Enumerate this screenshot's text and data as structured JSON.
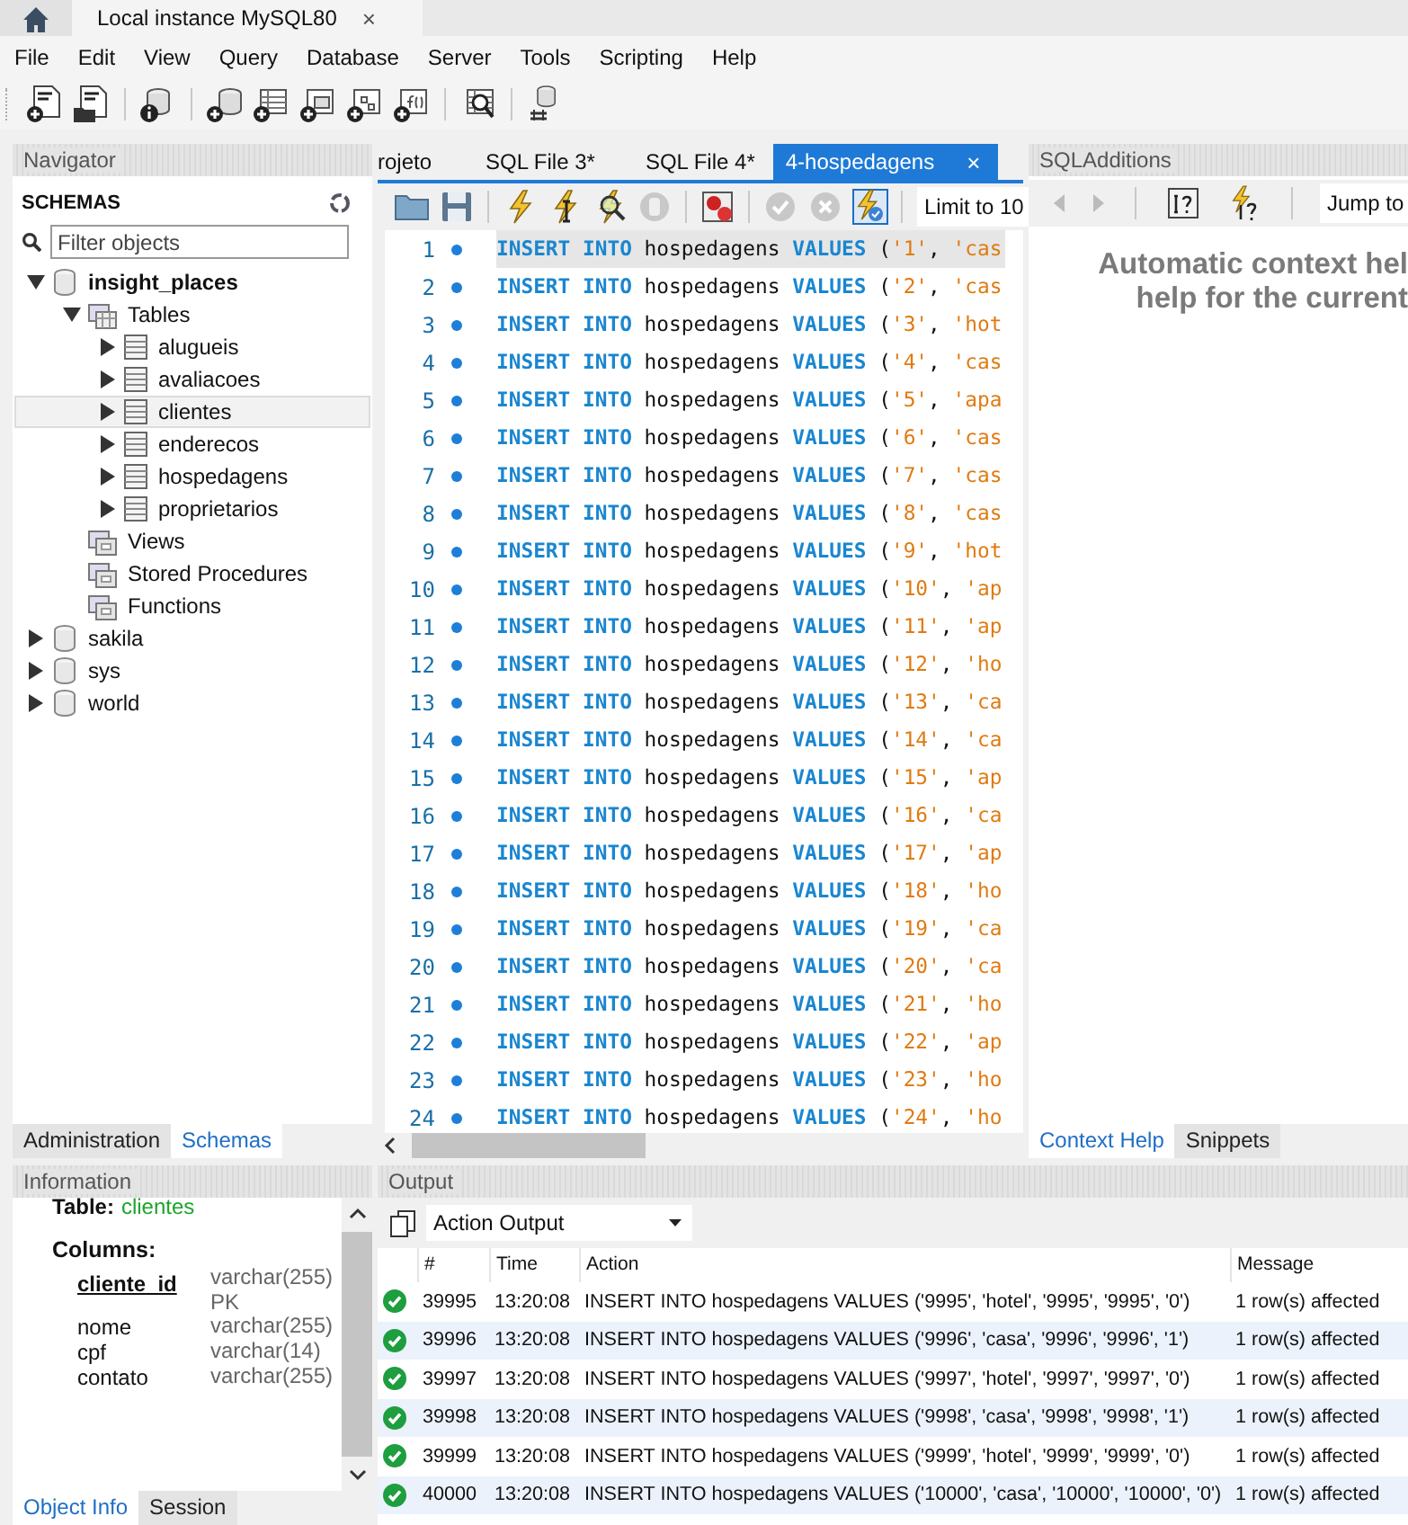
{
  "connection_tab": {
    "label": "Local instance MySQL80",
    "close": "×"
  },
  "menu": [
    "File",
    "Edit",
    "View",
    "Query",
    "Database",
    "Server",
    "Tools",
    "Scripting",
    "Help"
  ],
  "navigator": {
    "title": "Navigator",
    "heading": "SCHEMAS",
    "filter": {
      "placeholder": "Filter objects"
    },
    "tree": [
      {
        "label": "insight_places",
        "kind": "schema",
        "default": true,
        "expanded": true,
        "selected": false,
        "children": [
          {
            "label": "Tables",
            "kind": "folder",
            "expanded": true,
            "selected": false,
            "children": [
              {
                "label": "alugueis",
                "kind": "table",
                "expanded": false,
                "selected": false
              },
              {
                "label": "avaliacoes",
                "kind": "table",
                "expanded": false,
                "selected": false
              },
              {
                "label": "clientes",
                "kind": "table",
                "expanded": false,
                "selected": true
              },
              {
                "label": "enderecos",
                "kind": "table",
                "expanded": false,
                "selected": false
              },
              {
                "label": "hospedagens",
                "kind": "table",
                "expanded": false,
                "selected": false
              },
              {
                "label": "proprietarios",
                "kind": "table",
                "expanded": false,
                "selected": false
              }
            ]
          },
          {
            "label": "Views",
            "kind": "group",
            "selected": false
          },
          {
            "label": "Stored Procedures",
            "kind": "group",
            "selected": false
          },
          {
            "label": "Functions",
            "kind": "group",
            "selected": false
          }
        ]
      },
      {
        "label": "sakila",
        "kind": "schema",
        "default": false,
        "expanded": false,
        "selected": false
      },
      {
        "label": "sys",
        "kind": "schema",
        "default": false,
        "expanded": false,
        "selected": false
      },
      {
        "label": "world",
        "kind": "schema",
        "default": false,
        "expanded": false,
        "selected": false
      }
    ],
    "tabs": [
      {
        "label": "Administration",
        "selected": false
      },
      {
        "label": "Schemas",
        "selected": true
      }
    ]
  },
  "editor": {
    "tabs": [
      {
        "label": "rojeto",
        "selected": false
      },
      {
        "label": "SQL File 3*",
        "selected": false
      },
      {
        "label": "SQL File 4*",
        "selected": false
      },
      {
        "label": "4-hospedagens",
        "selected": true,
        "close": "×"
      }
    ],
    "limit": {
      "value": "Limit to 10"
    },
    "lines": [
      {
        "number": "1",
        "current": true,
        "tokens": [
          {
            "kind": "keyword",
            "text": "INSERT INTO "
          },
          {
            "kind": "plain",
            "text": "hospedagens "
          },
          {
            "kind": "keyword",
            "text": "VALUES "
          },
          {
            "kind": "plain",
            "text": "("
          },
          {
            "kind": "string",
            "text": "'1'"
          },
          {
            "kind": "plain",
            "text": ", "
          },
          {
            "kind": "string",
            "text": "'cas"
          }
        ]
      },
      {
        "number": "2",
        "current": false,
        "tokens": [
          {
            "kind": "keyword",
            "text": "INSERT INTO "
          },
          {
            "kind": "plain",
            "text": "hospedagens "
          },
          {
            "kind": "keyword",
            "text": "VALUES "
          },
          {
            "kind": "plain",
            "text": "("
          },
          {
            "kind": "string",
            "text": "'2'"
          },
          {
            "kind": "plain",
            "text": ", "
          },
          {
            "kind": "string",
            "text": "'cas"
          }
        ]
      },
      {
        "number": "3",
        "current": false,
        "tokens": [
          {
            "kind": "keyword",
            "text": "INSERT INTO "
          },
          {
            "kind": "plain",
            "text": "hospedagens "
          },
          {
            "kind": "keyword",
            "text": "VALUES "
          },
          {
            "kind": "plain",
            "text": "("
          },
          {
            "kind": "string",
            "text": "'3'"
          },
          {
            "kind": "plain",
            "text": ", "
          },
          {
            "kind": "string",
            "text": "'hot"
          }
        ]
      },
      {
        "number": "4",
        "current": false,
        "tokens": [
          {
            "kind": "keyword",
            "text": "INSERT INTO "
          },
          {
            "kind": "plain",
            "text": "hospedagens "
          },
          {
            "kind": "keyword",
            "text": "VALUES "
          },
          {
            "kind": "plain",
            "text": "("
          },
          {
            "kind": "string",
            "text": "'4'"
          },
          {
            "kind": "plain",
            "text": ", "
          },
          {
            "kind": "string",
            "text": "'cas"
          }
        ]
      },
      {
        "number": "5",
        "current": false,
        "tokens": [
          {
            "kind": "keyword",
            "text": "INSERT INTO "
          },
          {
            "kind": "plain",
            "text": "hospedagens "
          },
          {
            "kind": "keyword",
            "text": "VALUES "
          },
          {
            "kind": "plain",
            "text": "("
          },
          {
            "kind": "string",
            "text": "'5'"
          },
          {
            "kind": "plain",
            "text": ", "
          },
          {
            "kind": "string",
            "text": "'apa"
          }
        ]
      },
      {
        "number": "6",
        "current": false,
        "tokens": [
          {
            "kind": "keyword",
            "text": "INSERT INTO "
          },
          {
            "kind": "plain",
            "text": "hospedagens "
          },
          {
            "kind": "keyword",
            "text": "VALUES "
          },
          {
            "kind": "plain",
            "text": "("
          },
          {
            "kind": "string",
            "text": "'6'"
          },
          {
            "kind": "plain",
            "text": ", "
          },
          {
            "kind": "string",
            "text": "'cas"
          }
        ]
      },
      {
        "number": "7",
        "current": false,
        "tokens": [
          {
            "kind": "keyword",
            "text": "INSERT INTO "
          },
          {
            "kind": "plain",
            "text": "hospedagens "
          },
          {
            "kind": "keyword",
            "text": "VALUES "
          },
          {
            "kind": "plain",
            "text": "("
          },
          {
            "kind": "string",
            "text": "'7'"
          },
          {
            "kind": "plain",
            "text": ", "
          },
          {
            "kind": "string",
            "text": "'cas"
          }
        ]
      },
      {
        "number": "8",
        "current": false,
        "tokens": [
          {
            "kind": "keyword",
            "text": "INSERT INTO "
          },
          {
            "kind": "plain",
            "text": "hospedagens "
          },
          {
            "kind": "keyword",
            "text": "VALUES "
          },
          {
            "kind": "plain",
            "text": "("
          },
          {
            "kind": "string",
            "text": "'8'"
          },
          {
            "kind": "plain",
            "text": ", "
          },
          {
            "kind": "string",
            "text": "'cas"
          }
        ]
      },
      {
        "number": "9",
        "current": false,
        "tokens": [
          {
            "kind": "keyword",
            "text": "INSERT INTO "
          },
          {
            "kind": "plain",
            "text": "hospedagens "
          },
          {
            "kind": "keyword",
            "text": "VALUES "
          },
          {
            "kind": "plain",
            "text": "("
          },
          {
            "kind": "string",
            "text": "'9'"
          },
          {
            "kind": "plain",
            "text": ", "
          },
          {
            "kind": "string",
            "text": "'hot"
          }
        ]
      },
      {
        "number": "10",
        "current": false,
        "tokens": [
          {
            "kind": "keyword",
            "text": "INSERT INTO "
          },
          {
            "kind": "plain",
            "text": "hospedagens "
          },
          {
            "kind": "keyword",
            "text": "VALUES "
          },
          {
            "kind": "plain",
            "text": "("
          },
          {
            "kind": "string",
            "text": "'10'"
          },
          {
            "kind": "plain",
            "text": ", "
          },
          {
            "kind": "string",
            "text": "'ap"
          }
        ]
      },
      {
        "number": "11",
        "current": false,
        "tokens": [
          {
            "kind": "keyword",
            "text": "INSERT INTO "
          },
          {
            "kind": "plain",
            "text": "hospedagens "
          },
          {
            "kind": "keyword",
            "text": "VALUES "
          },
          {
            "kind": "plain",
            "text": "("
          },
          {
            "kind": "string",
            "text": "'11'"
          },
          {
            "kind": "plain",
            "text": ", "
          },
          {
            "kind": "string",
            "text": "'ap"
          }
        ]
      },
      {
        "number": "12",
        "current": false,
        "tokens": [
          {
            "kind": "keyword",
            "text": "INSERT INTO "
          },
          {
            "kind": "plain",
            "text": "hospedagens "
          },
          {
            "kind": "keyword",
            "text": "VALUES "
          },
          {
            "kind": "plain",
            "text": "("
          },
          {
            "kind": "string",
            "text": "'12'"
          },
          {
            "kind": "plain",
            "text": ", "
          },
          {
            "kind": "string",
            "text": "'ho"
          }
        ]
      },
      {
        "number": "13",
        "current": false,
        "tokens": [
          {
            "kind": "keyword",
            "text": "INSERT INTO "
          },
          {
            "kind": "plain",
            "text": "hospedagens "
          },
          {
            "kind": "keyword",
            "text": "VALUES "
          },
          {
            "kind": "plain",
            "text": "("
          },
          {
            "kind": "string",
            "text": "'13'"
          },
          {
            "kind": "plain",
            "text": ", "
          },
          {
            "kind": "string",
            "text": "'ca"
          }
        ]
      },
      {
        "number": "14",
        "current": false,
        "tokens": [
          {
            "kind": "keyword",
            "text": "INSERT INTO "
          },
          {
            "kind": "plain",
            "text": "hospedagens "
          },
          {
            "kind": "keyword",
            "text": "VALUES "
          },
          {
            "kind": "plain",
            "text": "("
          },
          {
            "kind": "string",
            "text": "'14'"
          },
          {
            "kind": "plain",
            "text": ", "
          },
          {
            "kind": "string",
            "text": "'ca"
          }
        ]
      },
      {
        "number": "15",
        "current": false,
        "tokens": [
          {
            "kind": "keyword",
            "text": "INSERT INTO "
          },
          {
            "kind": "plain",
            "text": "hospedagens "
          },
          {
            "kind": "keyword",
            "text": "VALUES "
          },
          {
            "kind": "plain",
            "text": "("
          },
          {
            "kind": "string",
            "text": "'15'"
          },
          {
            "kind": "plain",
            "text": ", "
          },
          {
            "kind": "string",
            "text": "'ap"
          }
        ]
      },
      {
        "number": "16",
        "current": false,
        "tokens": [
          {
            "kind": "keyword",
            "text": "INSERT INTO "
          },
          {
            "kind": "plain",
            "text": "hospedagens "
          },
          {
            "kind": "keyword",
            "text": "VALUES "
          },
          {
            "kind": "plain",
            "text": "("
          },
          {
            "kind": "string",
            "text": "'16'"
          },
          {
            "kind": "plain",
            "text": ", "
          },
          {
            "kind": "string",
            "text": "'ca"
          }
        ]
      },
      {
        "number": "17",
        "current": false,
        "tokens": [
          {
            "kind": "keyword",
            "text": "INSERT INTO "
          },
          {
            "kind": "plain",
            "text": "hospedagens "
          },
          {
            "kind": "keyword",
            "text": "VALUES "
          },
          {
            "kind": "plain",
            "text": "("
          },
          {
            "kind": "string",
            "text": "'17'"
          },
          {
            "kind": "plain",
            "text": ", "
          },
          {
            "kind": "string",
            "text": "'ap"
          }
        ]
      },
      {
        "number": "18",
        "current": false,
        "tokens": [
          {
            "kind": "keyword",
            "text": "INSERT INTO "
          },
          {
            "kind": "plain",
            "text": "hospedagens "
          },
          {
            "kind": "keyword",
            "text": "VALUES "
          },
          {
            "kind": "plain",
            "text": "("
          },
          {
            "kind": "string",
            "text": "'18'"
          },
          {
            "kind": "plain",
            "text": ", "
          },
          {
            "kind": "string",
            "text": "'ho"
          }
        ]
      },
      {
        "number": "19",
        "current": false,
        "tokens": [
          {
            "kind": "keyword",
            "text": "INSERT INTO "
          },
          {
            "kind": "plain",
            "text": "hospedagens "
          },
          {
            "kind": "keyword",
            "text": "VALUES "
          },
          {
            "kind": "plain",
            "text": "("
          },
          {
            "kind": "string",
            "text": "'19'"
          },
          {
            "kind": "plain",
            "text": ", "
          },
          {
            "kind": "string",
            "text": "'ca"
          }
        ]
      },
      {
        "number": "20",
        "current": false,
        "tokens": [
          {
            "kind": "keyword",
            "text": "INSERT INTO "
          },
          {
            "kind": "plain",
            "text": "hospedagens "
          },
          {
            "kind": "keyword",
            "text": "VALUES "
          },
          {
            "kind": "plain",
            "text": "("
          },
          {
            "kind": "string",
            "text": "'20'"
          },
          {
            "kind": "plain",
            "text": ", "
          },
          {
            "kind": "string",
            "text": "'ca"
          }
        ]
      },
      {
        "number": "21",
        "current": false,
        "tokens": [
          {
            "kind": "keyword",
            "text": "INSERT INTO "
          },
          {
            "kind": "plain",
            "text": "hospedagens "
          },
          {
            "kind": "keyword",
            "text": "VALUES "
          },
          {
            "kind": "plain",
            "text": "("
          },
          {
            "kind": "string",
            "text": "'21'"
          },
          {
            "kind": "plain",
            "text": ", "
          },
          {
            "kind": "string",
            "text": "'ho"
          }
        ]
      },
      {
        "number": "22",
        "current": false,
        "tokens": [
          {
            "kind": "keyword",
            "text": "INSERT INTO "
          },
          {
            "kind": "plain",
            "text": "hospedagens "
          },
          {
            "kind": "keyword",
            "text": "VALUES "
          },
          {
            "kind": "plain",
            "text": "("
          },
          {
            "kind": "string",
            "text": "'22'"
          },
          {
            "kind": "plain",
            "text": ", "
          },
          {
            "kind": "string",
            "text": "'ap"
          }
        ]
      },
      {
        "number": "23",
        "current": false,
        "tokens": [
          {
            "kind": "keyword",
            "text": "INSERT INTO "
          },
          {
            "kind": "plain",
            "text": "hospedagens "
          },
          {
            "kind": "keyword",
            "text": "VALUES "
          },
          {
            "kind": "plain",
            "text": "("
          },
          {
            "kind": "string",
            "text": "'23'"
          },
          {
            "kind": "plain",
            "text": ", "
          },
          {
            "kind": "string",
            "text": "'ho"
          }
        ]
      },
      {
        "number": "24",
        "current": false,
        "tokens": [
          {
            "kind": "keyword",
            "text": "INSERT INTO "
          },
          {
            "kind": "plain",
            "text": "hospedagens "
          },
          {
            "kind": "keyword",
            "text": "VALUES "
          },
          {
            "kind": "plain",
            "text": "("
          },
          {
            "kind": "string",
            "text": "'24'"
          },
          {
            "kind": "plain",
            "text": ", "
          },
          {
            "kind": "string",
            "text": "'ho"
          }
        ]
      }
    ]
  },
  "sql_additions": {
    "title": "SQLAdditions",
    "jump_to": {
      "value": "Jump to"
    },
    "help_text": [
      "Automatic context hel",
      "help for the current"
    ],
    "tabs": [
      {
        "label": "Context Help",
        "selected": true
      },
      {
        "label": "Snippets",
        "selected": false
      }
    ]
  },
  "information": {
    "title": "Information",
    "table_label": "Table:",
    "table_name": "clientes",
    "columns_heading": "Columns:",
    "columns": [
      {
        "name": "cliente_id",
        "type": "varchar(255)",
        "primary_key": true,
        "key_label": "PK"
      },
      {
        "name": "nome",
        "type": "varchar(255)",
        "primary_key": false
      },
      {
        "name": "cpf",
        "type": "varchar(14)",
        "primary_key": false
      },
      {
        "name": "contato",
        "type": "varchar(255)",
        "primary_key": false
      }
    ],
    "tabs": [
      {
        "label": "Object Info",
        "selected": true
      },
      {
        "label": "Session",
        "selected": false
      }
    ]
  },
  "output": {
    "title": "Output",
    "mode": {
      "value": "Action Output"
    },
    "columns": [
      "#",
      "Time",
      "Action",
      "Message"
    ],
    "rows": [
      {
        "number": "39995",
        "time": "13:20:08",
        "action": "INSERT INTO hospedagens VALUES ('9995', 'hotel', '9995', '9995', '0')",
        "message": "1 row(s) affected"
      },
      {
        "number": "39996",
        "time": "13:20:08",
        "action": "INSERT INTO hospedagens VALUES ('9996', 'casa', '9996', '9996', '1')",
        "message": "1 row(s) affected"
      },
      {
        "number": "39997",
        "time": "13:20:08",
        "action": "INSERT INTO hospedagens VALUES ('9997', 'hotel', '9997', '9997', '0')",
        "message": "1 row(s) affected"
      },
      {
        "number": "39998",
        "time": "13:20:08",
        "action": "INSERT INTO hospedagens VALUES ('9998', 'casa', '9998', '9998', '1')",
        "message": "1 row(s) affected"
      },
      {
        "number": "39999",
        "time": "13:20:08",
        "action": "INSERT INTO hospedagens VALUES ('9999', 'hotel', '9999', '9999', '0')",
        "message": "1 row(s) affected"
      },
      {
        "number": "40000",
        "time": "13:20:08",
        "action": "INSERT INTO hospedagens VALUES ('10000', 'casa', '10000', '10000', '0')",
        "message": "1 row(s) affected"
      }
    ]
  }
}
